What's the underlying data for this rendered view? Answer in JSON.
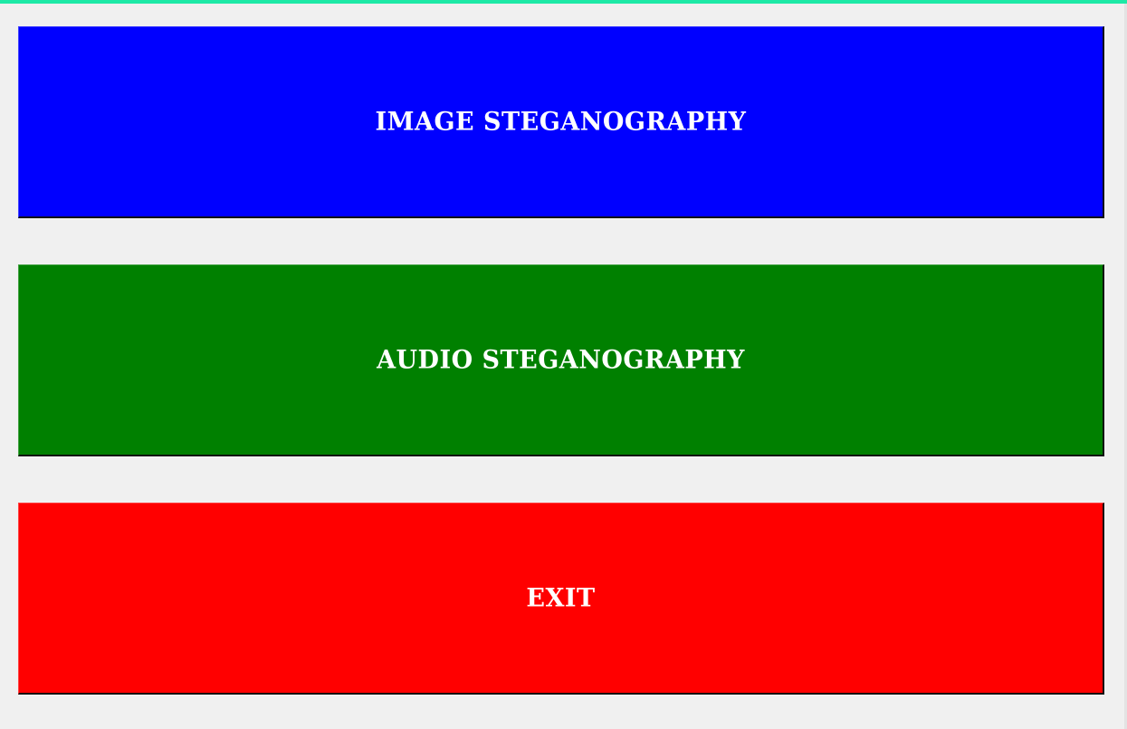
{
  "theme": {
    "accent": "#1de9a6",
    "background": "#f0f0f0"
  },
  "menu": {
    "image_steganography": {
      "label": "IMAGE STEGANOGRAPHY",
      "color": "#0000ff"
    },
    "audio_steganography": {
      "label": "AUDIO STEGANOGRAPHY",
      "color": "#008000"
    },
    "exit": {
      "label": "EXIT",
      "color": "#ff0000"
    }
  }
}
